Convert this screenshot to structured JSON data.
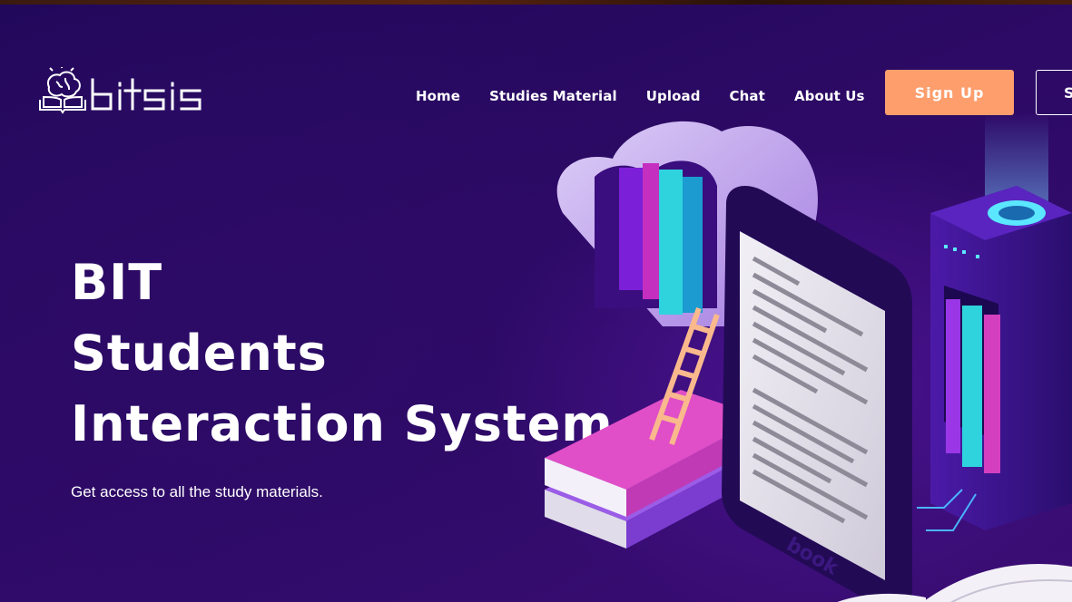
{
  "brand": {
    "logo_text": "bitsis",
    "logo_icon": "brain-book-icon"
  },
  "nav": {
    "items": [
      {
        "label": "Home"
      },
      {
        "label": "Studies Material"
      },
      {
        "label": "Upload"
      },
      {
        "label": "Chat"
      },
      {
        "label": "About Us"
      }
    ]
  },
  "header": {
    "signup_label": "Sign Up",
    "signin_label": "S"
  },
  "hero": {
    "title_lines": [
      "BIT",
      "Students",
      "Interaction System"
    ],
    "subtitle": "Get access to all the study materials.",
    "illustration": {
      "ebook_text": "book",
      "icons": [
        "cloud-library-icon",
        "ladder-icon",
        "ebook-reader-icon",
        "server-tower-icon",
        "open-book-icon"
      ]
    }
  },
  "colors": {
    "background": "#2a0a5e",
    "accent_button": "#fd9e6c",
    "text": "#ffffff"
  }
}
